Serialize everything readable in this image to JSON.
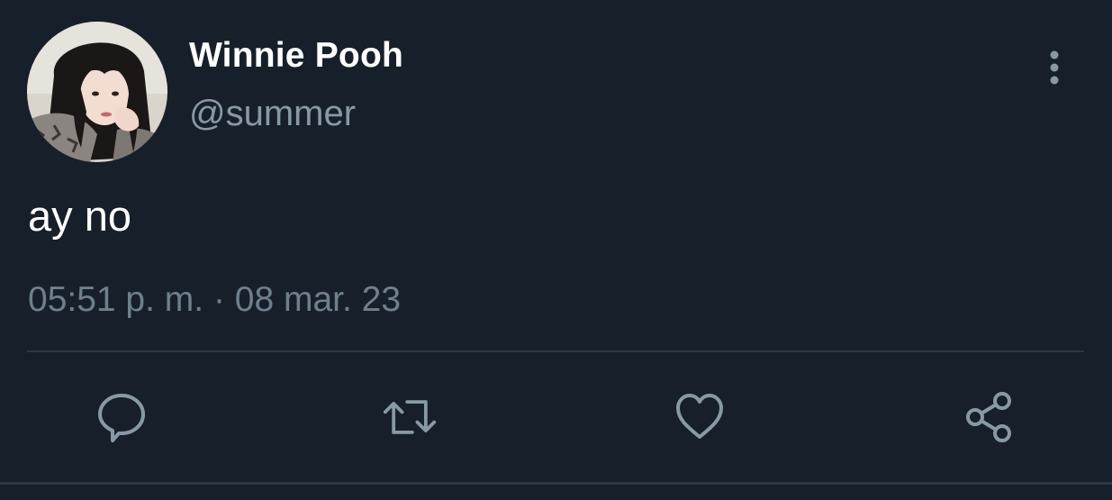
{
  "tweet": {
    "display_name": "Winnie Pooh",
    "handle": "@summer",
    "text": "ay no",
    "timestamp": "05:51 p. m. · 08 mar. 23"
  },
  "icons": {
    "more": "more-vertical-icon",
    "reply": "reply-icon",
    "retweet": "retweet-icon",
    "like": "heart-icon",
    "share": "share-icon"
  },
  "colors": {
    "background": "#17202a",
    "text_primary": "#ffffff",
    "text_secondary": "#8899a6",
    "icon": "#8899a6",
    "divider": "#2c3743"
  }
}
